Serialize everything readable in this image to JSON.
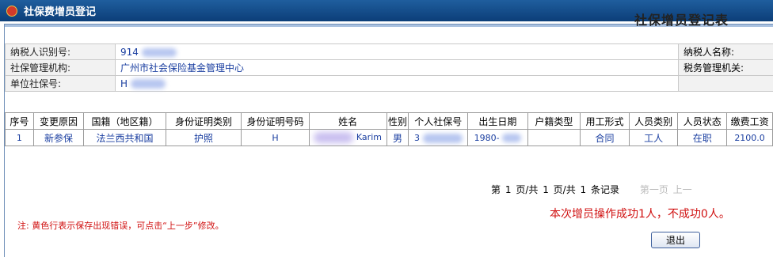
{
  "window": {
    "title": "社保费增员登记"
  },
  "page_title": "社保增员登记表",
  "info": {
    "taxpayer_id_label": "纳税人识别号:",
    "taxpayer_id_value": "914",
    "taxpayer_name_label": "纳税人名称:",
    "agency_label": "社保管理机构:",
    "agency_value": "广州市社会保险基金管理中心",
    "tax_office_label": "税务管理机关:",
    "unit_no_label": "单位社保号:",
    "unit_no_value": "H"
  },
  "table": {
    "headers": [
      "序号",
      "变更原因",
      "国籍（地区籍）",
      "身份证明类别",
      "身份证明号码",
      "姓名",
      "性别",
      "个人社保号",
      "出生日期",
      "户籍类型",
      "用工形式",
      "人员类别",
      "人员状态",
      "缴费工资"
    ],
    "row": {
      "seq": "1",
      "reason": "新参保",
      "nationality": "法兰西共和国",
      "id_type": "护照",
      "id_no": "H",
      "name": "Karim",
      "gender": "男",
      "social_no": "3",
      "birth": "1980-",
      "hukou": "",
      "employment": "合同",
      "category": "工人",
      "status": "在职",
      "wage": "2100.0"
    }
  },
  "pager": {
    "p1": "第",
    "current": "1",
    "p2": "页/共",
    "pages": "1",
    "p3": "页/共",
    "records": "1",
    "p4": "条记录",
    "nav": "第一页 上一"
  },
  "note": "注:  黄色行表示保存出现错误，可点击“上一步”修改。",
  "result": "本次增员操作成功1人，不成功0人。",
  "exit_label": "退出"
}
